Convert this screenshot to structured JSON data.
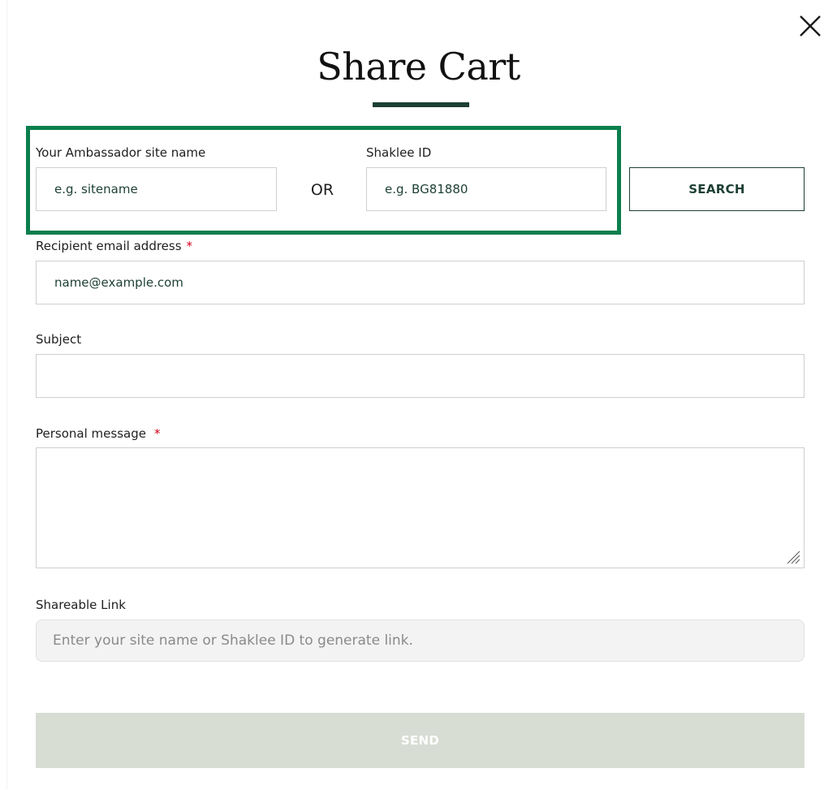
{
  "modal": {
    "title": "Share Cart",
    "close_icon": "close-icon"
  },
  "lookup": {
    "site_name_label": "Your Ambassador site name",
    "site_name_placeholder": "e.g. sitename",
    "or_text": "OR",
    "shaklee_id_label": "Shaklee ID",
    "shaklee_id_placeholder": "e.g. BG81880",
    "search_label": "SEARCH",
    "highlight_color": "#0b7f4d"
  },
  "recipient": {
    "label": "Recipient email address",
    "required_mark": "*",
    "placeholder": "name@example.com"
  },
  "subject": {
    "label": "Subject",
    "value": ""
  },
  "message": {
    "label": "Personal message",
    "required_mark": "*",
    "value": ""
  },
  "shareable_link": {
    "label": "Shareable Link",
    "placeholder": "Enter your site name or Shaklee ID to generate link."
  },
  "send": {
    "label": "SEND"
  },
  "colors": {
    "brand_dark_green": "#1d3f33",
    "required_red": "#d0021b",
    "send_disabled_bg": "#d7ddd3"
  }
}
